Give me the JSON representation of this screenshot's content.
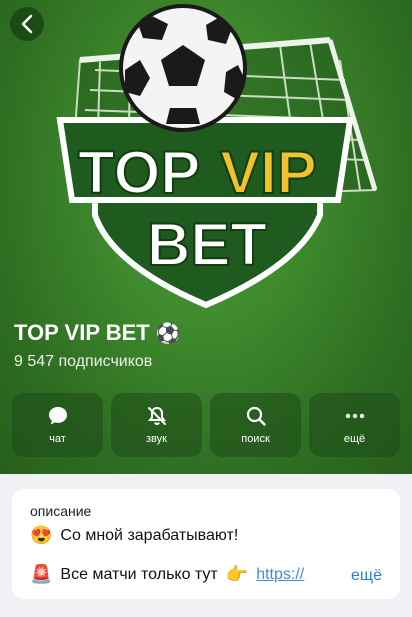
{
  "channel": {
    "name": "TOP VIP BET",
    "name_emoji": "⚽",
    "subscribers": "9 547 подписчиков",
    "logo_text": [
      "TOP",
      "VIP",
      "BET"
    ]
  },
  "actions": [
    {
      "label": "чат",
      "icon": "chat-icon"
    },
    {
      "label": "звук",
      "icon": "bell-off-icon"
    },
    {
      "label": "поиск",
      "icon": "search-icon"
    },
    {
      "label": "ещё",
      "icon": "more-icon"
    }
  ],
  "description": {
    "label": "описание",
    "line1_emoji": "😍",
    "line1": "Со мной зарабатывают!",
    "line2_emoji": "🚨",
    "line2": "Все матчи только тут",
    "line2_emoji2": "👉",
    "link": "https://",
    "more": "ещё"
  },
  "colors": {
    "hero_green": "#3f8a2d",
    "logo_yellow": "#f2c12e",
    "link_blue": "#2a7fd4"
  }
}
